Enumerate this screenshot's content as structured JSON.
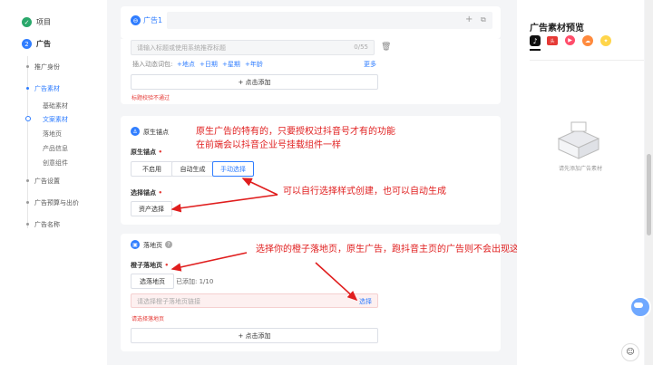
{
  "sidebar": {
    "steps": [
      {
        "label": "项目",
        "badge": "✓"
      },
      {
        "label": "广告",
        "badge": "2"
      }
    ],
    "items": [
      {
        "label": "推广身份"
      },
      {
        "label": "广告素材"
      },
      {
        "label": "广告设置"
      },
      {
        "label": "广告预算与出价"
      },
      {
        "label": "广告名称"
      }
    ],
    "subitems": [
      {
        "label": "基础素材"
      },
      {
        "label": "文案素材"
      },
      {
        "label": "落地页"
      },
      {
        "label": "产品信息"
      },
      {
        "label": "创意组件"
      }
    ]
  },
  "tabbar": {
    "tab_label": "广告1",
    "add": "+",
    "copy": "⧉"
  },
  "title_section": {
    "placeholder": "请输入标题或使用系统推荐标题",
    "counter": "0/55",
    "insert_label": "插入动态词包:",
    "words": [
      "+地点",
      "+日期",
      "+星期",
      "+年龄"
    ],
    "more": "更多",
    "add_label": "+ 点击添加",
    "error": "标题校验不通过"
  },
  "anchor_section": {
    "title": "原生锚点",
    "field_label": "原生锚点",
    "options": [
      "不启用",
      "自动生成",
      "手动选择"
    ],
    "select_label": "选择锚点",
    "asset_button": "资产选择"
  },
  "landing_section": {
    "title": "落地页",
    "field_label": "橙子落地页",
    "select_button": "选落地页",
    "added": "已添加: 1/10",
    "input_placeholder": "请选择橙子落地页链接",
    "select_link": "选择",
    "error": "请选择落地页",
    "add_label": "+ 点击添加"
  },
  "preview": {
    "title": "广告素材预览",
    "empty_text": "请先添加广告素材",
    "icons": [
      "douyin-icon",
      "toutiao-icon",
      "xigua-icon",
      "huoshan-icon",
      "pipixia-icon"
    ]
  },
  "annotations": [
    "原生广告的特有的，只要授权过抖音号才有的功能",
    "在前端会以抖音企业号挂载组件一样",
    "可以自行选择样式创建，也可以自动生成",
    "选择你的橙子落地页，原生广告，跑抖音主页的广告则不会出现这个选项"
  ],
  "colors": {
    "accent": "#2f7dff",
    "success": "#2aa86b",
    "error": "#e53935",
    "annotation": "#e01e1e"
  }
}
